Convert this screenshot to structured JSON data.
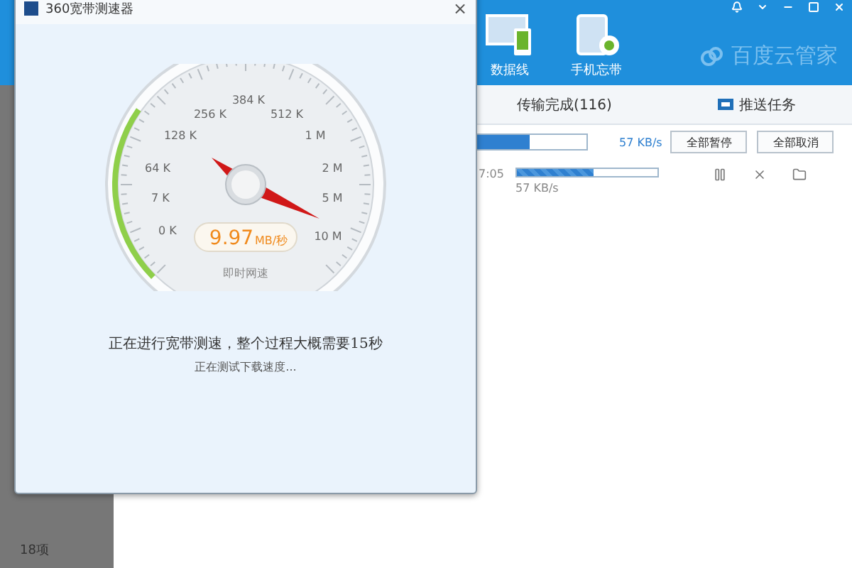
{
  "app": {
    "toolbar": [
      {
        "label": "数据线",
        "kind": "devices"
      },
      {
        "label": "手机忘带",
        "kind": "phone"
      }
    ],
    "logo": "百度云管家",
    "tabs": [
      {
        "label": "传输完成(116)",
        "kind": "text",
        "selected": false
      },
      {
        "label": "推送任务",
        "kind": "push",
        "selected": false
      }
    ],
    "summary": {
      "level": 0.7,
      "speed": "57 KB/s",
      "buttons": [
        "全部暂停",
        "全部取消"
      ]
    },
    "task": {
      "time": "7:05",
      "level": 0.55,
      "speed": "57 KB/s"
    },
    "sidebar": {
      "count": "18项"
    }
  },
  "dialog": {
    "title": "360宽带测速器",
    "close": "×",
    "gauge": {
      "labels": [
        "0 K",
        "7 K",
        "64 K",
        "128 K",
        "256 K",
        "384 K",
        "512 K",
        "1 M",
        "2 M",
        "5 M",
        "10 M"
      ],
      "value": "9.97",
      "unit": "MB/秒",
      "caption": "即时网速"
    },
    "message": "正在进行宽带测速，整个过程大概需要15秒",
    "status": "正在测试下载速度..."
  }
}
